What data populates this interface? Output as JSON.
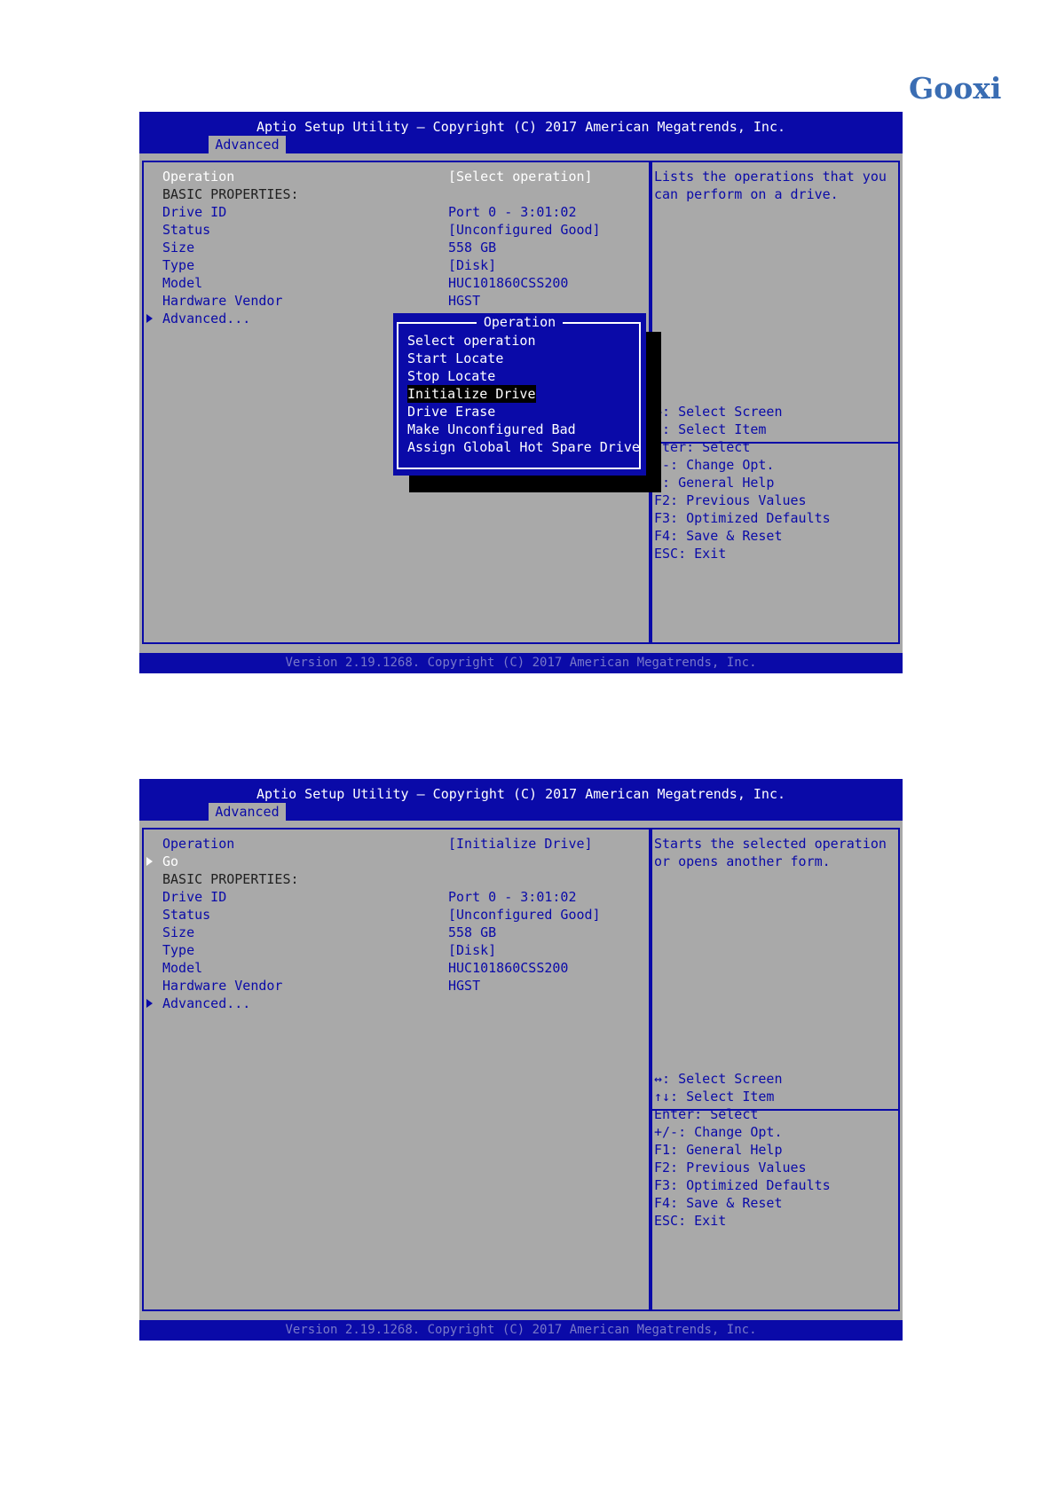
{
  "brand": {
    "logo_text": "Gooxi"
  },
  "screens": [
    {
      "header_title": "Aptio Setup Utility – Copyright (C) 2017 American Megatrends, Inc.",
      "active_tab": "Advanced",
      "rows": [
        {
          "label": "Operation",
          "value": "[Select operation]"
        },
        {
          "label": "BASIC PROPERTIES:",
          "value": ""
        },
        {
          "label": "Drive ID",
          "value": "Port 0 - 3:01:02"
        },
        {
          "label": "Status",
          "value": "[Unconfigured Good]"
        },
        {
          "label": "Size",
          "value": "558 GB"
        },
        {
          "label": "Type",
          "value": "[Disk]"
        },
        {
          "label": "Model",
          "value": "HUC101860CSS200"
        },
        {
          "label": "Hardware Vendor",
          "value": "HGST"
        },
        {
          "label": "Advanced...",
          "value": ""
        }
      ],
      "help_text": [
        "Lists the operations that you",
        "can perform on a drive."
      ],
      "keys": [
        "↔: Select Screen",
        "↓: Select Item",
        "nter: Select",
        "/-: Change Opt.",
        "1: General Help",
        "F2: Previous Values",
        "F3: Optimized Defaults",
        "F4: Save & Reset",
        "ESC: Exit"
      ],
      "popup": {
        "title": "Operation",
        "options": [
          "Select operation",
          "Start Locate",
          "Stop Locate",
          "Initialize Drive",
          "Drive Erase",
          "Make Unconfigured Bad",
          "Assign Global Hot Spare Drive"
        ],
        "selected": "Initialize Drive"
      },
      "footer": "Version 2.19.1268. Copyright (C) 2017 American Megatrends, Inc."
    },
    {
      "header_title": "Aptio Setup Utility – Copyright (C) 2017 American Megatrends, Inc.",
      "active_tab": "Advanced",
      "rows": [
        {
          "label": "Operation",
          "value": "[Initialize Drive]"
        },
        {
          "label": "Go",
          "value": ""
        },
        {
          "label": "BASIC PROPERTIES:",
          "value": ""
        },
        {
          "label": "Drive ID",
          "value": "Port 0 - 3:01:02"
        },
        {
          "label": "Status",
          "value": "[Unconfigured Good]"
        },
        {
          "label": "Size",
          "value": "558 GB"
        },
        {
          "label": "Type",
          "value": "[Disk]"
        },
        {
          "label": "Model",
          "value": "HUC101860CSS200"
        },
        {
          "label": "Hardware Vendor",
          "value": "HGST"
        },
        {
          "label": "Advanced...",
          "value": ""
        }
      ],
      "help_text": [
        "Starts the selected operation",
        "or opens another form."
      ],
      "keys": [
        "↔: Select Screen",
        "↑↓: Select Item",
        "Enter: Select",
        "+/-: Change Opt.",
        "F1: General Help",
        "F2: Previous Values",
        "F3: Optimized Defaults",
        "F4: Save & Reset",
        "ESC: Exit"
      ],
      "footer": "Version 2.19.1268. Copyright (C) 2017 American Megatrends, Inc."
    }
  ]
}
